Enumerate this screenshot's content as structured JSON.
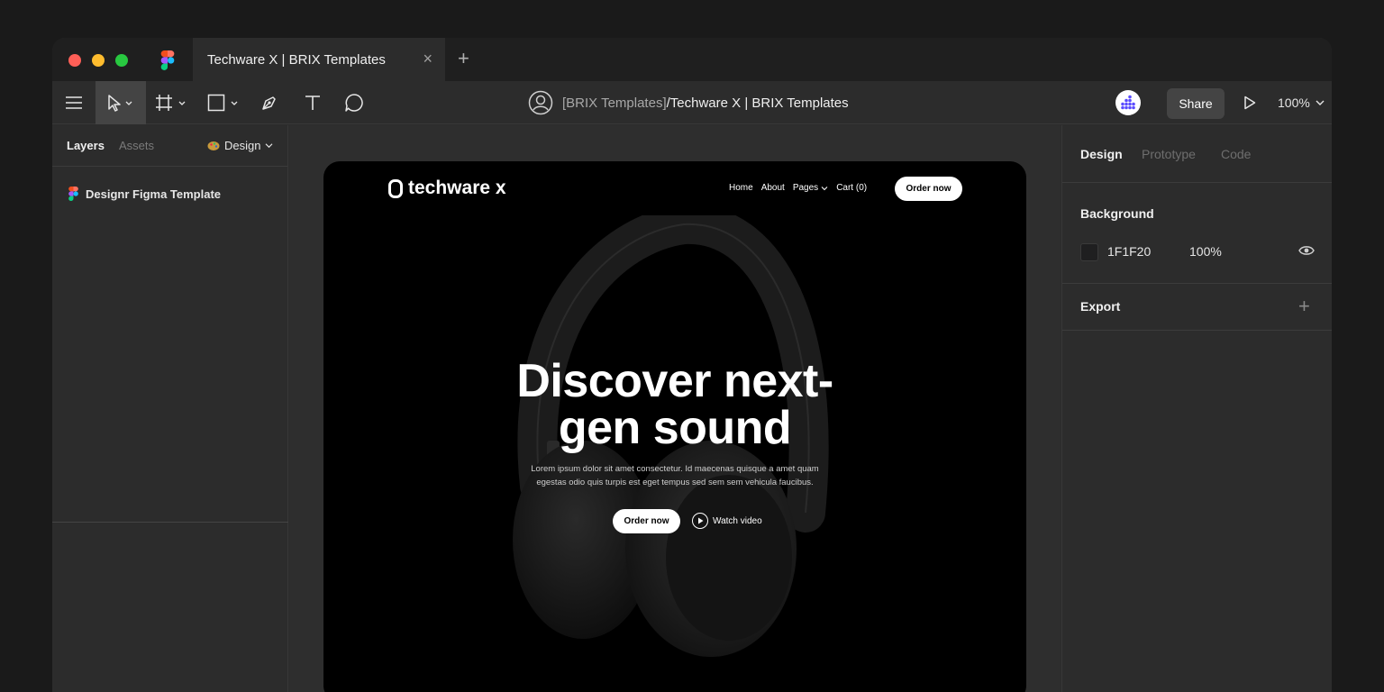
{
  "window": {
    "tab_title": "Techware X | BRIX Templates",
    "tab_close": "×",
    "tab_add": "+"
  },
  "toolbar": {
    "tools": [
      "menu-icon",
      "move-tool-icon",
      "frame-tool-icon",
      "shape-tool-icon",
      "pen-tool-icon",
      "text-tool-icon",
      "comment-tool-icon"
    ],
    "doc_path_team": "[BRIX Templates]",
    "doc_path_file": "/Techware X | BRIX Templates",
    "share_label": "Share",
    "zoom_label": "100%"
  },
  "left_panel": {
    "tab_layers": "Layers",
    "tab_assets": "Assets",
    "page_select": "Design",
    "layers": [
      {
        "label": "Designr Figma Template"
      }
    ]
  },
  "canvas": {
    "site": {
      "logo_text": "techware x",
      "nav": [
        "Home",
        "About",
        "Pages",
        "Cart (0)"
      ],
      "nav_cta": "Order now",
      "hero_title_line1": "Discover next-",
      "hero_title_line2": "gen sound",
      "hero_subtitle": "Lorem ipsum dolor sit amet consectetur. Id maecenas quisque a amet quam egestas odio quis turpis est eget tempus sed sem sem vehicula faucibus.",
      "hero_cta": "Order now",
      "hero_video": "Watch video"
    }
  },
  "right_panel": {
    "tab_design": "Design",
    "tab_prototype": "Prototype",
    "tab_code": "Code",
    "background_heading": "Background",
    "background_hex": "1F1F20",
    "background_opacity": "100%",
    "export_heading": "Export",
    "export_add": "+"
  },
  "colors": {
    "background_swatch": "#1F1F20",
    "traffic_red": "#FE5F57",
    "traffic_yellow": "#FEBC2E",
    "traffic_green": "#28C840"
  }
}
